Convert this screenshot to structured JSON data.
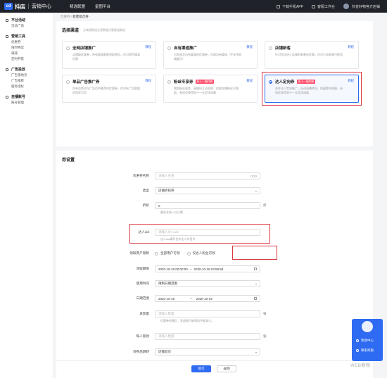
{
  "topbar": {
    "logo_mark": "cd",
    "logo_text": "抖店",
    "logo_sub": "营销中心",
    "nav": [
      "精选联盟",
      "星图平台"
    ],
    "download": "下载手机APP",
    "service": "客服工作台",
    "shop": "抖音好物官方店铺"
  },
  "sidebar": {
    "groups": [
      {
        "title": "平台活动",
        "items": [
          "活动广场"
        ]
      },
      {
        "title": "营销工具",
        "items": [
          "优惠券",
          "限时特卖",
          "满减",
          "定时开售"
        ]
      },
      {
        "title": "广告投放",
        "items": [
          "广告落地页",
          "广告推荐",
          "服务指标"
        ]
      },
      {
        "title": "自播账号",
        "items": [
          "账号管理"
        ]
      }
    ]
  },
  "breadcrumb": {
    "parent": "优惠券",
    "sep": "/",
    "current": "新建批次券"
  },
  "channel": {
    "title": "选择渠道",
    "hint": "全域通渠道全面覆盖优惠渠道渠道",
    "tutorial": "教程",
    "options": [
      {
        "title": "全网店铺推广",
        "tag": "",
        "desc": "店铺级优惠券，所有渠道都能领取使用，仅可提供满减优惠",
        "selected": false
      },
      {
        "title": "自有渠道推广",
        "tag": "",
        "desc": "可发放至自有渠道的优惠券，仅限自有渠道（不支持商城展示）",
        "selected": false
      },
      {
        "title": "店铺新客",
        "tag": "",
        "desc": "针对首次进入店铺的新客送优惠，仅对小店新客可使用",
        "selected": false
      },
      {
        "title": "单品广告推广券",
        "tag": "",
        "desc": "在单品商详与广告页中推荐的优惠券，仅对有广告渠道的商家可用",
        "selected": false
      },
      {
        "title": "粉丝专享券",
        "tag": "双十一福利券",
        "desc": "增加粉丝粘性，直播间互动说明，仅限店铺粉丝可领取，有机会获得双十一全会场流量",
        "selected": false
      },
      {
        "title": "达人定向券",
        "tag": "双十一福利券",
        "desc": "合作达人定向推广，促进直播转化，快速提升销量，有机会获得双十一全会场流量",
        "selected": true
      }
    ]
  },
  "form": {
    "section_title": "券设置",
    "fields": {
      "name": {
        "label": "优惠券名称",
        "placeholder": "请输入名称",
        "counter": "0/10"
      },
      "type": {
        "label": "类型",
        "value": "店铺折扣券"
      },
      "discount": {
        "label": "折扣",
        "value": "0",
        "unit": "折",
        "help": "最多支持一位小数"
      },
      "uid": {
        "label": "达人uid",
        "placeholder": "请输入达人uid",
        "help": "达人uid填写合作达人抖音号"
      },
      "claim": {
        "label": "领取用户限制",
        "options": [
          "全部用户可领",
          "仅达人粉丝可领"
        ]
      },
      "claim_period": {
        "label": "领取期限",
        "start": "2020-10-19 00:00:00",
        "sep": "~",
        "end": "2020-10-19 23:59:59"
      },
      "use_time": {
        "label": "使用时间",
        "value": "限制日期范围"
      },
      "date_range": {
        "label": "日期范围",
        "start": "2020-10-19",
        "sep": "~",
        "end": "2020-10-19"
      },
      "quantity": {
        "label": "发放量",
        "placeholder": "请输入数量",
        "unit": "张",
        "help": "优惠券创建后，发放量只能增加不能减少。"
      },
      "per_user": {
        "label": "每人限领",
        "placeholder": "请输入数量",
        "unit": "张"
      },
      "after_claim": {
        "label": "领券后跳转",
        "value": "店铺首页"
      }
    }
  },
  "footer": {
    "submit": "提交",
    "back": "返回"
  },
  "float_panel": {
    "help": "帮助中心",
    "contact": "联系商服"
  },
  "watermark": "WEB教程"
}
